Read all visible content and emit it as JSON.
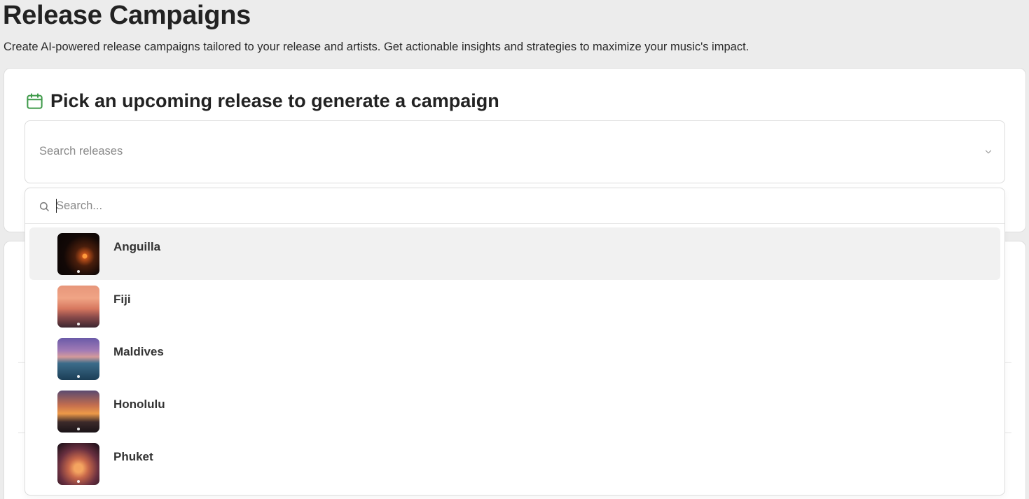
{
  "page": {
    "title": "Release Campaigns",
    "subtitle": "Create AI-powered release campaigns tailored to your release and artists. Get actionable insights and strategies to maximize your music's impact."
  },
  "picker": {
    "heading": "Pick an upcoming release to generate a campaign",
    "heading_icon": "calendar-icon",
    "select_placeholder": "Search releases",
    "search_placeholder": "Search...",
    "search_value": "",
    "options": [
      {
        "label": "Anguilla",
        "thumbnail": "sunset-palm-photo",
        "active": true
      },
      {
        "label": "Fiji",
        "thumbnail": "sunset-sea-photo",
        "active": false
      },
      {
        "label": "Maldives",
        "thumbnail": "overwater-villas-photo",
        "active": false
      },
      {
        "label": "Honolulu",
        "thumbnail": "sunset-beach-photo",
        "active": false
      },
      {
        "label": "Phuket",
        "thumbnail": "sunset-trees-photo",
        "active": false
      }
    ]
  },
  "colors": {
    "accent_green": "#3f9a4a",
    "page_background": "#ececec",
    "active_option_background": "#f1f1f1"
  }
}
